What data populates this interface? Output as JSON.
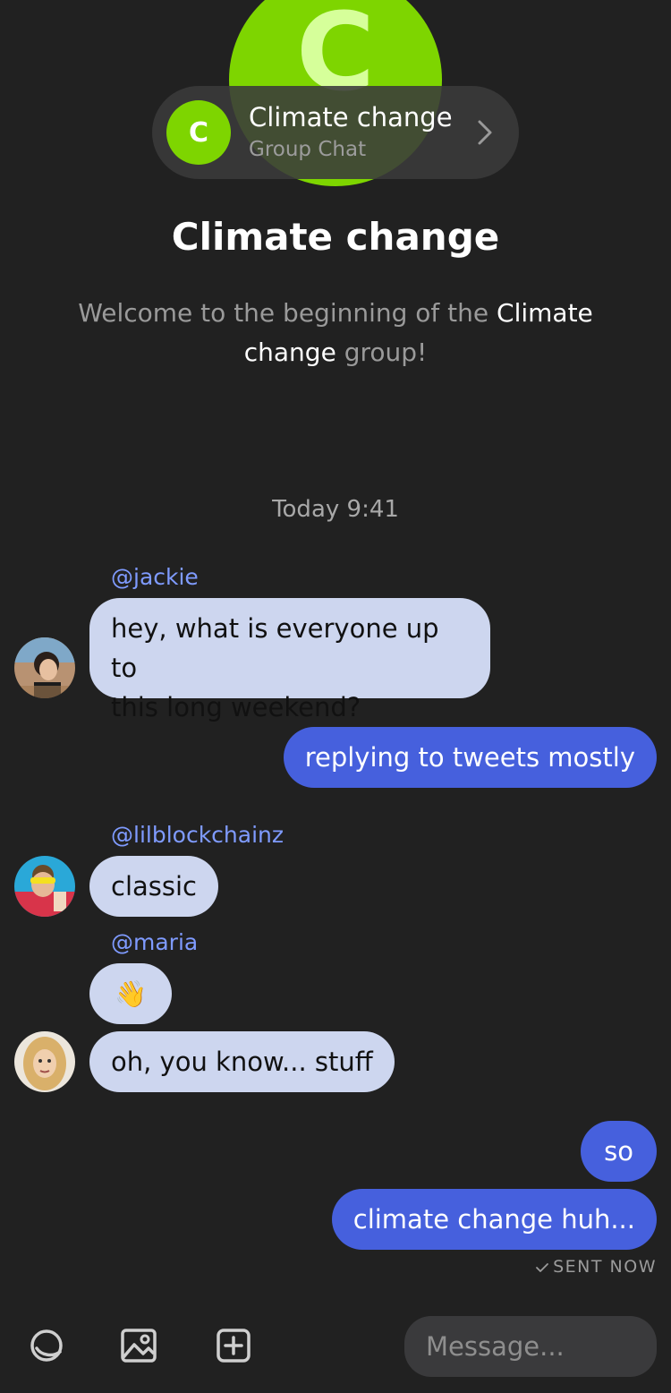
{
  "header": {
    "avatar_letter_big": "C",
    "avatar_letter": "C",
    "title": "Climate change",
    "subtitle": "Group Chat"
  },
  "group_title": "Climate change",
  "welcome": {
    "prefix": "Welcome to the beginning of the ",
    "group_name": "Climate change",
    "suffix": " group!"
  },
  "timestamp": "Today 9:41",
  "messages": {
    "m1": {
      "user": "@jackie",
      "text_line1": "hey, what is everyone up to",
      "text_line2": "this long weekend?"
    },
    "m2": {
      "text": "replying to tweets mostly"
    },
    "m3": {
      "user": "@lilblockchainz",
      "text": "classic"
    },
    "m4": {
      "user": "@maria",
      "emoji": "👋"
    },
    "m5": {
      "text": "oh, you know... stuff"
    },
    "m6": {
      "text": "so"
    },
    "m7": {
      "text": "climate change huh..."
    }
  },
  "sent_status": "SENT NOW",
  "composer": {
    "placeholder": "Message..."
  },
  "colors": {
    "background": "#212121",
    "group_green": "#7ed500",
    "incoming_bubble": "#cdd6ef",
    "outgoing_bubble": "#4660dd",
    "username": "#7f9bff"
  },
  "icons": {
    "sticker": "sticker-icon",
    "image": "image-icon",
    "add": "plus-square-icon",
    "chevron": "chevron-right-icon",
    "check": "check-icon"
  }
}
